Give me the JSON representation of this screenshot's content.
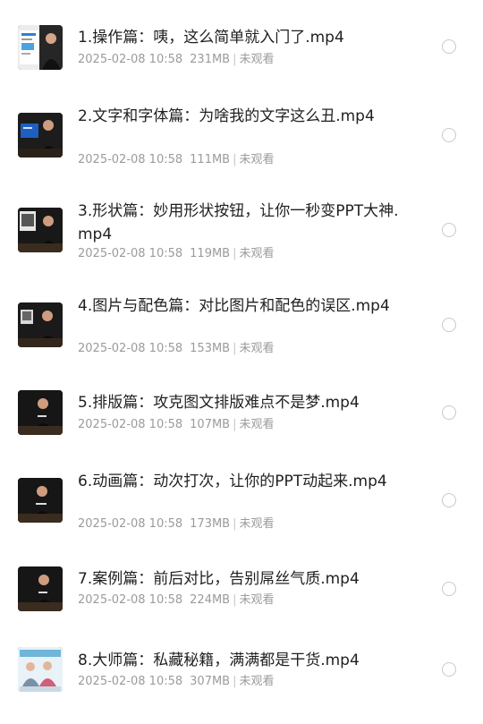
{
  "files": [
    {
      "title": "1.操作篇：咦，这么简单就入门了.mp4",
      "date": "2025-02-08 10:58",
      "size": "231MB",
      "status": "未观看",
      "thumb": "thumb-tutorial-slide"
    },
    {
      "title": "2.文字和字体篇：为啥我的文字这么丑.mp4",
      "date": "2025-02-08 10:58",
      "size": "111MB",
      "status": "未观看",
      "thumb": "thumb-presenter-blue-screen"
    },
    {
      "title": "3.形状篇：妙用形状按钮，让你一秒变PPT大神.mp4",
      "date": "2025-02-08 10:58",
      "size": "119MB",
      "status": "未观看",
      "thumb": "thumb-presenter-photo"
    },
    {
      "title": "4.图片与配色篇：对比图片和配色的误区.mp4",
      "date": "2025-02-08 10:58",
      "size": "153MB",
      "status": "未观看",
      "thumb": "thumb-presenter-photo"
    },
    {
      "title": "5.排版篇：攻克图文排版难点不是梦.mp4",
      "date": "2025-02-08 10:58",
      "size": "107MB",
      "status": "未观看",
      "thumb": "thumb-presenter"
    },
    {
      "title": "6.动画篇：动次打次，让你的PPT动起来.mp4",
      "date": "2025-02-08 10:58",
      "size": "173MB",
      "status": "未观看",
      "thumb": "thumb-presenter"
    },
    {
      "title": "7.案例篇：前后对比，告别屌丝气质.mp4",
      "date": "2025-02-08 10:58",
      "size": "224MB",
      "status": "未观看",
      "thumb": "thumb-presenter"
    },
    {
      "title": "8.大师篇：私藏秘籍，满满都是干货.mp4",
      "date": "2025-02-08 10:58",
      "size": "307MB",
      "status": "未观看",
      "thumb": "thumb-slide-collage"
    }
  ]
}
